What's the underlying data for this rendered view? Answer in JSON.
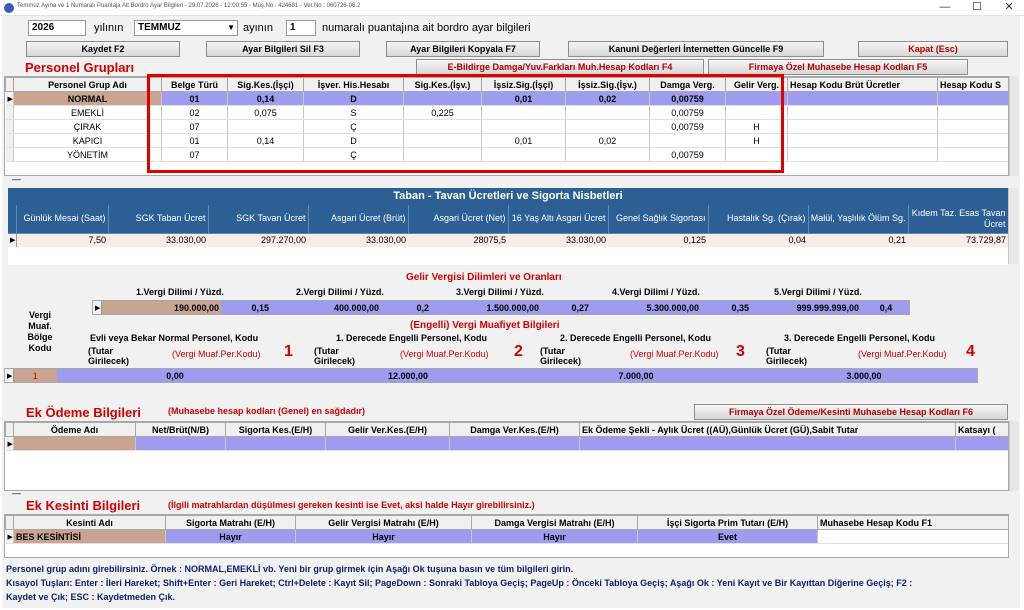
{
  "window": {
    "title": "Temmuz Ayına ve 1 Numaralı Puantaja Ait Bordro Ayar Bilgileri - 29.07.2026 - 12:00:55 - Müş.No : 424681 - Ver.No : 060726-06.2",
    "minimize": "—",
    "maximize": "☐",
    "close": "✕"
  },
  "top": {
    "year": "2026",
    "year_label": "yılının",
    "month": "TEMMUZ",
    "month_label": "ayının",
    "num": "1",
    "num_label": "numaralı puantajına ait bordro ayar bilgileri"
  },
  "buttons": {
    "save": "Kaydet F2",
    "delete": "Ayar Bilgileri Sil F3",
    "copy": "Ayar Bilgileri Kopyala F7",
    "update": "Kanuni Değerleri İnternetten Güncelle F9",
    "close": "Kapat (Esc)",
    "ebildirge": "E-Bildirge Damga/Yuv.Farkları Muh.Hesap Kodları F4",
    "firm_acc": "Firmaya Özel Muhasebe Hesap Kodları F5",
    "firm_pay": "Firmaya Özel Ödeme/Kesinti Muhasebe Hesap Kodları F6"
  },
  "personel": {
    "title": "Personel Grupları",
    "headers": [
      "Personel Grup Adı",
      "Belge Türü",
      "Sig.Kes.(İşçi)",
      "İşver. His.Hesabı",
      "Sig.Kes.(İşv.)",
      "İşsiz.Sig.(İşçi)",
      "İşsiz.Sig.(İşv.)",
      "Damga Verg.",
      "Gelir Verg.",
      "Hesap Kodu Brüt Ücretler",
      "Hesap Kodu S"
    ],
    "rows": [
      [
        "NORMAL",
        "01",
        "0,14",
        "D",
        "",
        "0,01",
        "0,02",
        "0,00759",
        ""
      ],
      [
        "EMEKLİ",
        "02",
        "0,075",
        "S",
        "0,225",
        "",
        "",
        "0,00759",
        ""
      ],
      [
        "ÇIRAK",
        "07",
        "",
        "Ç",
        "",
        "",
        "",
        "0,00759",
        "H"
      ],
      [
        "KAPICI",
        "01",
        "0,14",
        "D",
        "",
        "0,01",
        "0,02",
        "",
        "H"
      ],
      [
        "YÖNETİM",
        "07",
        "",
        "Ç",
        "",
        "",
        "",
        "0,00759",
        ""
      ]
    ],
    "dash": "—"
  },
  "taban": {
    "title": "Taban - Tavan Ücretleri ve Sigorta Nisbetleri",
    "headers": [
      "Günlük Mesai (Saat)",
      "SGK Taban Ücret",
      "SGK Tavan Ücret",
      "Asgari Ücret (Brüt)",
      "Asgari Ücret (Net)",
      "16 Yaş Altı Asgari Ücret",
      "Genel Sağlık Sigortası",
      "Hastalık Sg. (Çırak)",
      "Malül, Yaşlılık Ölüm Sg.",
      "Kıdem Taz. Esas Tavan Ücret"
    ],
    "values": [
      "7,50",
      "33.030,00",
      "297.270,00",
      "33.030,00",
      "28075,5",
      "33.030,00",
      "0,125",
      "0,04",
      "0,21",
      "73.729,87"
    ]
  },
  "gelir": {
    "title": "Gelir Vergisi Dilimleri ve Oranları",
    "headers": [
      "1.Vergi Dilimi  /  Yüzd.",
      "2.Vergi Dilimi  /  Yüzd.",
      "3.Vergi Dilimi  /  Yüzd.",
      "4.Vergi Dilimi  /  Yüzd.",
      "5.Vergi Dilimi  /  Yüzd."
    ],
    "values": [
      "190.000,00",
      "0,15",
      "400.000,00",
      "0,2",
      "1.500.000,00",
      "0,27",
      "5.300.000,00",
      "0,35",
      "999.999.999,00",
      "0,4"
    ]
  },
  "engelli": {
    "title": "(Engelli) Vergi Muafiyet Bilgileri",
    "side": "Vergi Muaf. Bölge Kodu",
    "cols": [
      {
        "head": "Evli veya Bekar Normal Personel, Kodu",
        "tutar": "(Tutar Girilecek)",
        "muaf": "(Vergi Muaf.Per.Kodu)",
        "num": "1",
        "value": "0,00"
      },
      {
        "head": "1. Derecede Engelli Personel, Kodu",
        "tutar": "(Tutar Girilecek)",
        "muaf": "(Vergi Muaf.Per.Kodu)",
        "num": "2",
        "value": "12.000,00"
      },
      {
        "head": "2. Derecede Engelli Personel, Kodu",
        "tutar": "(Tutar Girilecek)",
        "muaf": "(Vergi Muaf.Per.Kodu)",
        "num": "3",
        "value": "7.000,00"
      },
      {
        "head": "3. Derecede Engelli Personel, Kodu",
        "tutar": "(Tutar Girilecek)",
        "muaf": "(Vergi Muaf.Per.Kodu)",
        "num": "4",
        "value": "3.000,00"
      }
    ],
    "row_code": "1"
  },
  "ekodeme": {
    "title": "Ek Ödeme Bilgileri",
    "note": "(Muhasebe hesap kodları (Genel) en sağdadır)",
    "headers": [
      "Ödeme Adı",
      "Net/Brüt(N/B)",
      "Sigorta Kes.(E/H)",
      "Gelir Ver.Kes.(E/H)",
      "Damga Ver.Kes.(E/H)",
      "Ek Ödeme Şekli - Aylık Ücret ((AÜ),Günlük Ücret (GÜ),Sabit Tutar",
      "Katsayı ("
    ]
  },
  "ekkesinti": {
    "title": "Ek Kesinti Bilgileri",
    "note": "(İlgili matrahlardan düşülmesi gereken kesinti ise Evet, aksi halde Hayır girebilirsiniz.)",
    "headers": [
      "Kesinti Adı",
      "Sigorta Matrahı (E/H)",
      "Gelir Vergisi Matrahı (E/H)",
      "Damga Vergisi Matrahı (E/H)",
      "İşçi Sigorta Prim Tutarı (E/H)",
      "Muhasebe Hesap Kodu F1"
    ],
    "row": [
      "BES KESİNTİSİ",
      "Hayır",
      "Hayır",
      "Hayır",
      "Evet",
      ""
    ]
  },
  "footer": {
    "line1": "Personel grup adını girebilirsiniz. Örnek : NORMAL,EMEKLİ vb. Yeni bir grup girmek için Aşağı Ok tuşuna basın ve tüm bilgileri girin.",
    "line2": "Kısayol Tuşları: Enter : İleri Hareket; Shift+Enter : Geri Hareket; Ctrl+Delete : Kayıt Sil; PageDown : Sonraki Tabloya Geçiş; PageUp : Önceki Tabloya Geçiş; Aşağı Ok : Yeni Kayıt ve Bir Kayıttan Diğerine Geçiş; F2 :",
    "line3": "Kaydet ve Çık; ESC : Kaydetmeden Çık."
  },
  "colors": {
    "navy": "#2c5f93",
    "lavender": "#9d9cef",
    "tan": "#c9a591",
    "red": "#d40000"
  }
}
